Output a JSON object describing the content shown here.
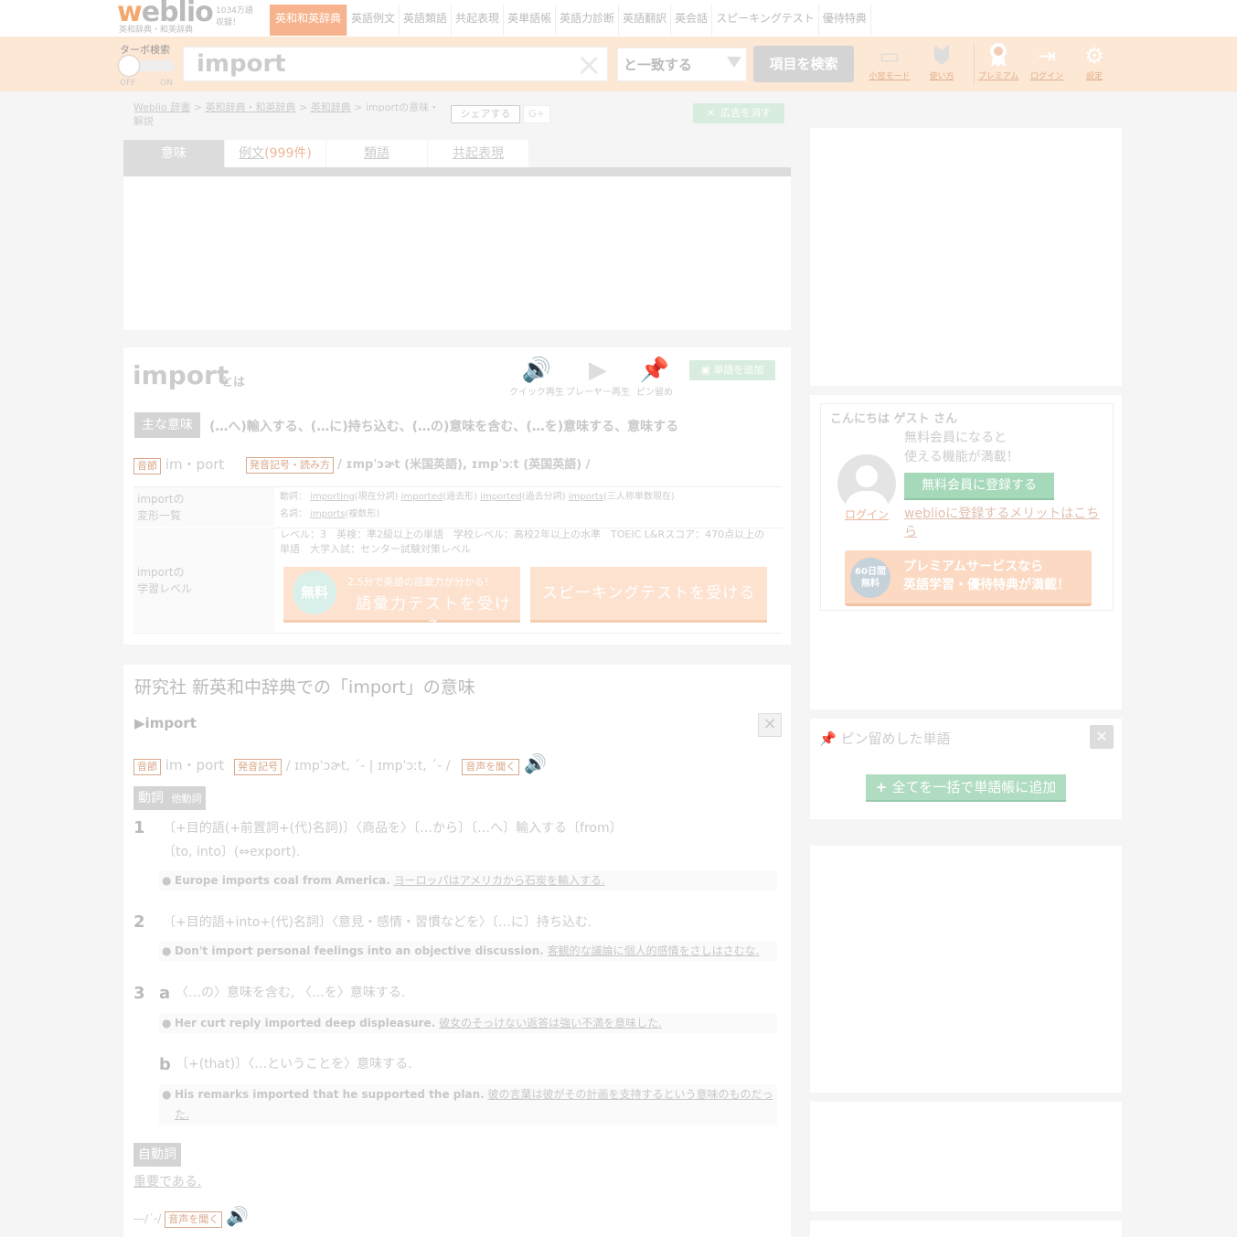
{
  "header": {
    "logo": "weblio",
    "logo_sub": "英和辞典・和英辞典",
    "word_count_line1": "1034万語",
    "word_count_line2": "収録！",
    "nav_tabs": [
      "英和和英辞典",
      "英語例文",
      "英語類語",
      "共起表現",
      "英単語帳",
      "英語力診断",
      "英語翻訳",
      "英会話",
      "スピーキングテスト",
      "優待特典"
    ]
  },
  "search": {
    "turbo_label": "ターボ検索",
    "turbo_off": "OFF",
    "turbo_on": "ON",
    "query": "import",
    "clear_icon": "×",
    "match_mode": "と一致する",
    "button": "項目を検索",
    "tools": [
      {
        "icon": "screen-icon",
        "label": "小窓モード"
      },
      {
        "icon": "beginner-icon",
        "label": "使い方"
      },
      {
        "icon": "medal-icon",
        "label": "プレミアム"
      },
      {
        "icon": "login-icon",
        "label": "ログイン"
      },
      {
        "icon": "gear-icon",
        "label": "設定"
      }
    ]
  },
  "breadcrumb": {
    "items": [
      "Weblio 辞書",
      "英和辞典・和英辞典",
      "英和辞典"
    ],
    "sep": " > ",
    "current": "importの意味・解説"
  },
  "share_label": "シェアする",
  "gplus_label": "G+",
  "hide_ads_label": "広告を消す",
  "tabs": {
    "meaning": "意味",
    "examples": "例文",
    "examples_count": "(999件)",
    "synonyms": "類語",
    "collocations": "共起表現"
  },
  "word": {
    "title": "import",
    "toha": "とは",
    "quick_play": "クイック再生",
    "player_play": "プレーヤー再生",
    "pin": "ピン留め",
    "add_to_wordbook": "単語を追加",
    "main_meaning_label": "主な意味",
    "main_meaning": "(…へ)輸入する、(…に)持ち込む、(…の)意味を含む、(…を)意味する、意味する",
    "syllable_label": "音節",
    "syllable": "im・port",
    "pron_label": "発音記号・読み方",
    "pron": "/ ɪmpˈɔɚt (米国英語), ɪmpˈɔːt (英国英語) /"
  },
  "conjugation": {
    "label_line1": "importの",
    "label_line2": "変形一覧",
    "verb_label": "動詞：",
    "verb_forms": [
      {
        "form": "importing",
        "desc": "(現在分詞)"
      },
      {
        "form": "imported",
        "desc": "(過去形)"
      },
      {
        "form": "imported",
        "desc": "(過去分詞)"
      },
      {
        "form": "imports",
        "desc": "(三人称単数現在)"
      }
    ],
    "noun_label": "名詞：",
    "noun_forms": [
      {
        "form": "imports",
        "desc": "(複数形)"
      }
    ]
  },
  "level": {
    "label_line1": "importの",
    "label_line2": "学習レベル",
    "info_line1": "レベル：3　英検：準2級以上の単語　学校レベル：高校2年以上の水準　TOEIC L&Rスコア：470点以上の",
    "info_line2": "単語　大学入試：センター試験対策レベル",
    "free_badge": "無料",
    "vocab_test_small": "2.5分で英語の語彙力が分かる！",
    "vocab_test_main": "語彙力テストを受ける",
    "speaking_test": "スピーキングテストを受ける"
  },
  "dictionary": {
    "title": "研究社 新英和中辞典での「import」の意味",
    "entry_head": "import",
    "syllable_label": "音節",
    "syllable": "im・port",
    "pron_label": "発音記号",
    "pron": "/ ɪmpˈɔɚt, ´- | ɪmpˈɔːt, ´- /",
    "listen_label": "音声を聞く",
    "pos_verb": "動詞",
    "pos_verb_sub": "他動詞",
    "senses": [
      {
        "num": "1",
        "line1": "〔+目的語(+前置詞+(代)名詞)〕〈商品を〉〔…から〕〔…へ〕輸入する〔from〕",
        "line2": "〔to, into〕(⇔export).",
        "example_en": "Europe imports coal from America.",
        "example_ja": "ヨーロッパはアメリカから石炭を輸入する."
      },
      {
        "num": "2",
        "line1": "〔+目的語+into+(代)名詞〕〈意見・感情・習慣などを〉〔…に〕持ち込む.",
        "example_en": "Don't import personal feelings into an objective discussion.",
        "example_ja": "客観的な議論に個人的感情をさしはさむな."
      },
      {
        "num": "3",
        "sub": "a",
        "line1": "〈…の〉意味を含む, 〈…を〉意味する.",
        "example_en": "Her curt reply imported deep displeasure.",
        "example_ja": "彼女のそっけない返答は強い不満を意味した."
      },
      {
        "sub": "b",
        "line1": "〔+(that)〕〈…ということを〉意味する.",
        "example_en": "His remarks imported that he supported the plan.",
        "example_ja_line1": "彼の言葉は彼がその計画を支持するという意味のものだっ",
        "example_ja_line2": "た."
      }
    ],
    "pos_intransitive": "自動詞",
    "intransitive_meaning": "重要である.",
    "intr_pron": "―/´-/",
    "intr_listen": "音声を聞く"
  },
  "sidebar": {
    "greeting": "こんにちは ゲスト さん",
    "member_line1": "無料会員になると",
    "member_line2": "使える機能が満載！",
    "login": "ログイン",
    "register": "無料会員に登録する",
    "merit": "weblioに登録するメリットはこちら",
    "premium_badge_line1": "60日間",
    "premium_badge_line2": "無料",
    "premium_line1": "プレミアムサービスなら",
    "premium_line2": "英語学習・優待特典が満載！",
    "pinned_title": "ピン留めした単語",
    "add_all": "全てを一括で単語帳に追加"
  },
  "colors": {
    "brand_orange": "#f7b38d",
    "search_bg": "#fde7d5",
    "green_button": "#a6d9b9",
    "gray_badge": "#d4d4d4"
  }
}
